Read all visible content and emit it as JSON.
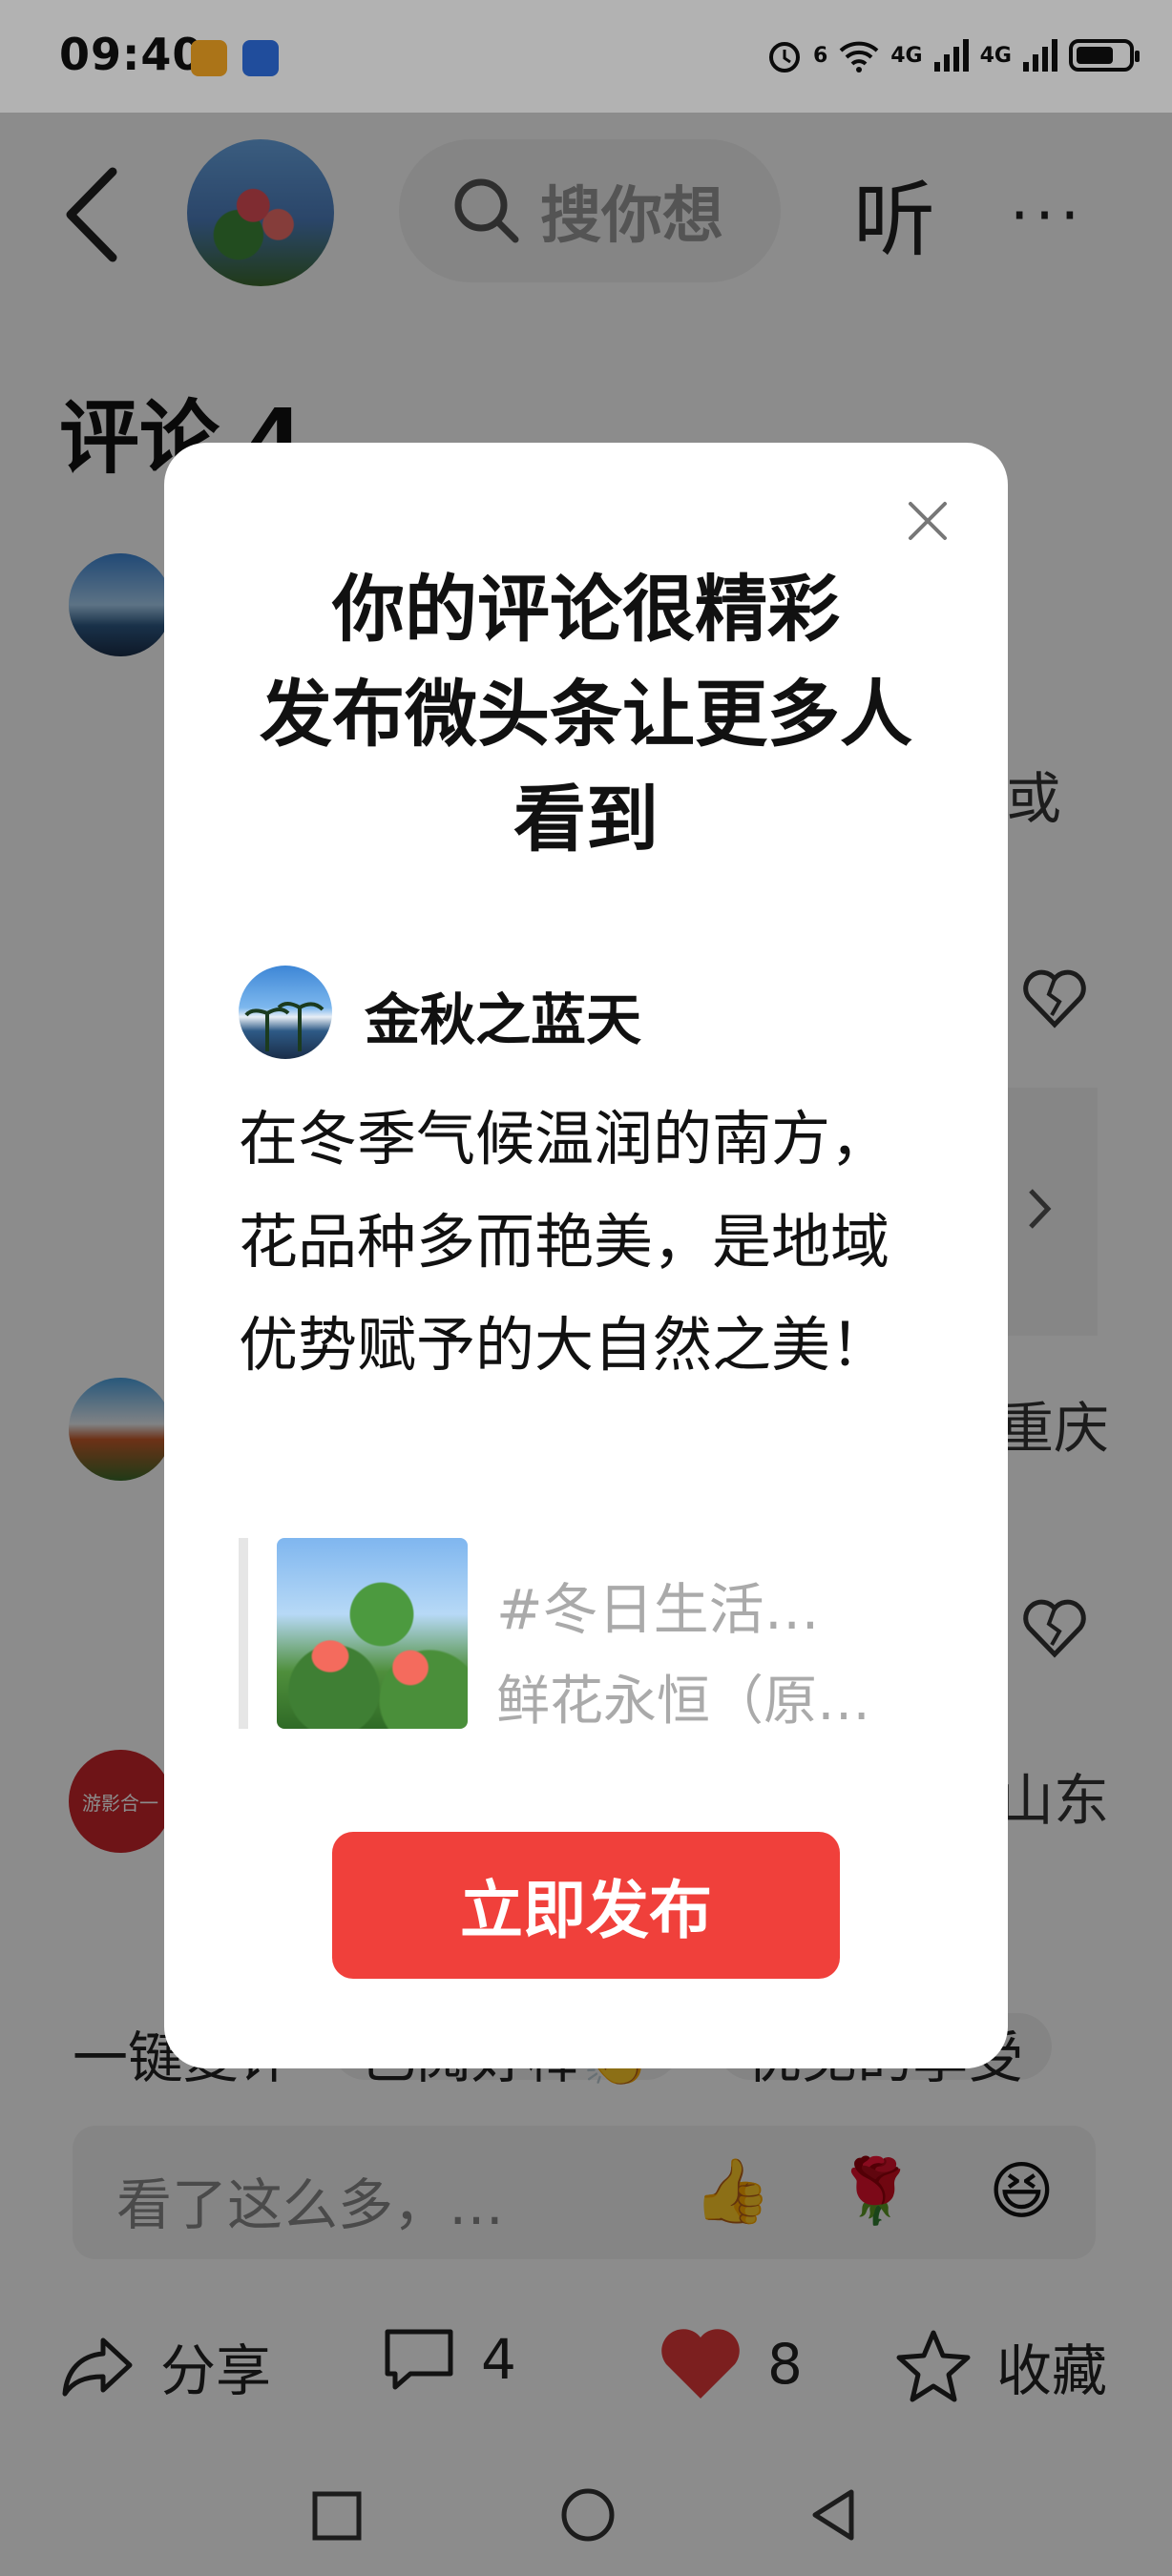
{
  "status_bar": {
    "time": "09:40",
    "net_1": "4G",
    "net_2": "4G",
    "wifi_label": "6"
  },
  "header": {
    "search_placeholder": "搜你想",
    "listen_label": "听",
    "more_label": "···"
  },
  "comments": {
    "title": "评论 4",
    "peek_text_1": "或",
    "peek_location_1": "重庆",
    "peek_location_2": "山东",
    "avatar_badge_text": "游影合一"
  },
  "bottom": {
    "chips": [
      "一键复评",
      "已阅好棒👏",
      "优见的享受"
    ],
    "comment_placeholder": "看了这么多，…",
    "emojis": [
      "👍",
      "🌹",
      "😆"
    ],
    "share_label": "分享",
    "comment_count": "4",
    "like_count": "8",
    "favorite_label": "收藏"
  },
  "modal": {
    "title_lines": [
      "你的评论很精彩",
      "发布微头条让更多人",
      "看到"
    ],
    "user_name": "金秋之蓝天",
    "comment_text": "在冬季气候温润的南方，花品种多而艳美，是地域优势赋予的大自然之美！",
    "quote_line_1": "#冬日生活…",
    "quote_line_2": "鲜花永恒（原…",
    "publish_button": "立即发布"
  },
  "colors": {
    "accent": "#f0403b",
    "overlay": "rgba(0,0,0,0.45)",
    "like": "#e23a3a"
  }
}
